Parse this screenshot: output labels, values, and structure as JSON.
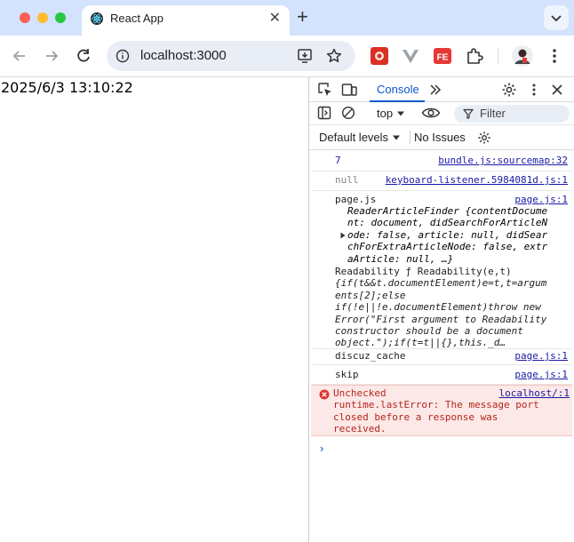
{
  "browser": {
    "tab_title": "React App",
    "tab_close_glyph": "✕",
    "new_tab_glyph": "+",
    "url": "localhost:3000"
  },
  "page": {
    "time": "2025/6/3 13:10:22"
  },
  "devtools": {
    "tabs": {
      "console": "Console"
    },
    "context": "top",
    "filter_placeholder": "Filter",
    "levels": "Default levels",
    "issues": "No Issues",
    "messages": [
      {
        "text": "7",
        "source": "bundle.js:sourcemap:32"
      },
      {
        "text": "null",
        "source": "keyboard-listener.5984081d.js:1"
      },
      {
        "text": "page.js",
        "source": "page.js:1"
      },
      {
        "text": "discuz_cache",
        "source": "page.js:1"
      },
      {
        "text": "skip",
        "source": "page.js:1"
      }
    ],
    "reader_object": {
      "name": "ReaderArticleFinder",
      "l1": " {contentDocume",
      "l2": "nt: document, didSearchForArticleN",
      "l3": "ode: false, article: null, didSear",
      "l4": "chForExtraArticleNode: false, extr",
      "l5": "aArticle: null, …}"
    },
    "readability": {
      "l1": "Readability ƒ Readability(e,t)",
      "l2": "{if(t&&t.documentElement)e=t,t=argum",
      "l3": "ents[2];else",
      "l4": "if(!e||!e.documentElement)throw new",
      "l5": "Error(\"First argument to Readability",
      "l6": "constructor should be a document",
      "l7": "object.\");if(t=t||{},this._d…"
    },
    "error": {
      "source": "localhost/:1",
      "l1": "Unchecked",
      "l2": "runtime.lastError: The message port",
      "l3": "closed before a response was",
      "l4": "received."
    },
    "prompt_glyph": "›"
  },
  "colors": {
    "tabstrip": "#d3e3fd",
    "accent": "#0b57d0",
    "error_bg": "#fce8e6",
    "error_text": "#b3261e"
  }
}
